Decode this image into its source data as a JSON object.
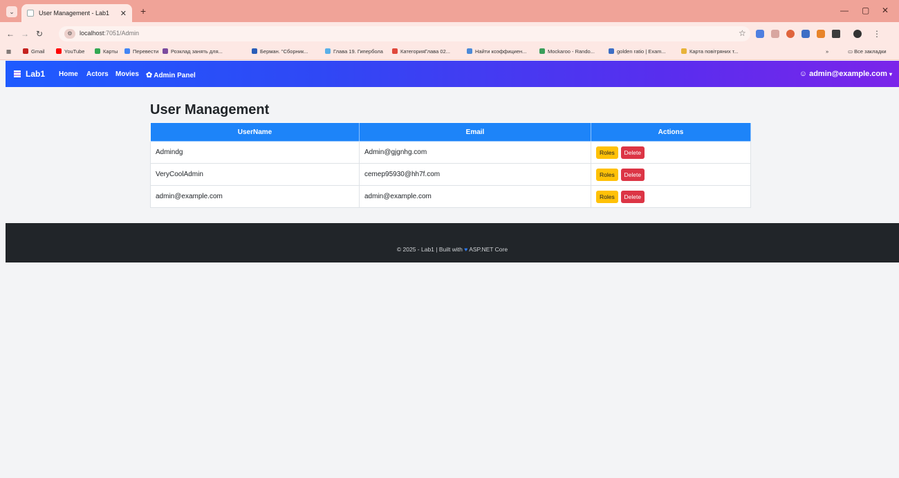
{
  "browser": {
    "tab_title": "User Management - Lab1",
    "url_host": "localhost",
    "url_path": ":7051/Admin",
    "bookmarks": [
      {
        "label": "Gmail",
        "color": "#c5221f"
      },
      {
        "label": "YouTube",
        "color": "#ff0000"
      },
      {
        "label": "Карты",
        "color": "#34a853"
      },
      {
        "label": "Перевести",
        "color": "#4285f4"
      },
      {
        "label": "Розклад занять для...",
        "color": "#7b4a9e"
      },
      {
        "label": "Берман. \"Сборник...",
        "color": "#2b5eb8"
      },
      {
        "label": "Глава 19. Гипербола",
        "color": "#5ab0e8"
      },
      {
        "label": "КатегорияГлава 02...",
        "color": "#e0483c"
      },
      {
        "label": "Найти коэффициен...",
        "color": "#4c8ad8"
      },
      {
        "label": "Mockaroo - Rando...",
        "color": "#3a9e5a"
      },
      {
        "label": "golden ratio | Exam...",
        "color": "#3d6ec5"
      },
      {
        "label": "Карта повітряних т...",
        "color": "#e8b33a"
      }
    ],
    "all_bookmarks": "Все закладки"
  },
  "navbar": {
    "brand": "Lab1",
    "links": [
      "Home",
      "Actors",
      "Movies",
      "Admin Panel"
    ],
    "user": "admin@example.com"
  },
  "main": {
    "title": "User Management",
    "columns": [
      "UserName",
      "Email",
      "Actions"
    ],
    "rows": [
      {
        "username": "Admindg",
        "email": "Admin@gjgnhg.com"
      },
      {
        "username": "VeryCoolAdmin",
        "email": "cemep95930@hh7f.com"
      },
      {
        "username": "admin@example.com",
        "email": "admin@example.com"
      }
    ],
    "roles_label": "Roles",
    "delete_label": "Delete"
  },
  "footer": {
    "text_before": "© 2025 - Lab1 | Built with",
    "text_after": "ASP.NET Core"
  },
  "colors": {
    "navbar_start": "#1e5bff",
    "navbar_end": "#7b25ea",
    "table_header": "#1d84f9",
    "roles_button": "#ffc107",
    "delete_button": "#dc3545",
    "footer": "#212529"
  }
}
